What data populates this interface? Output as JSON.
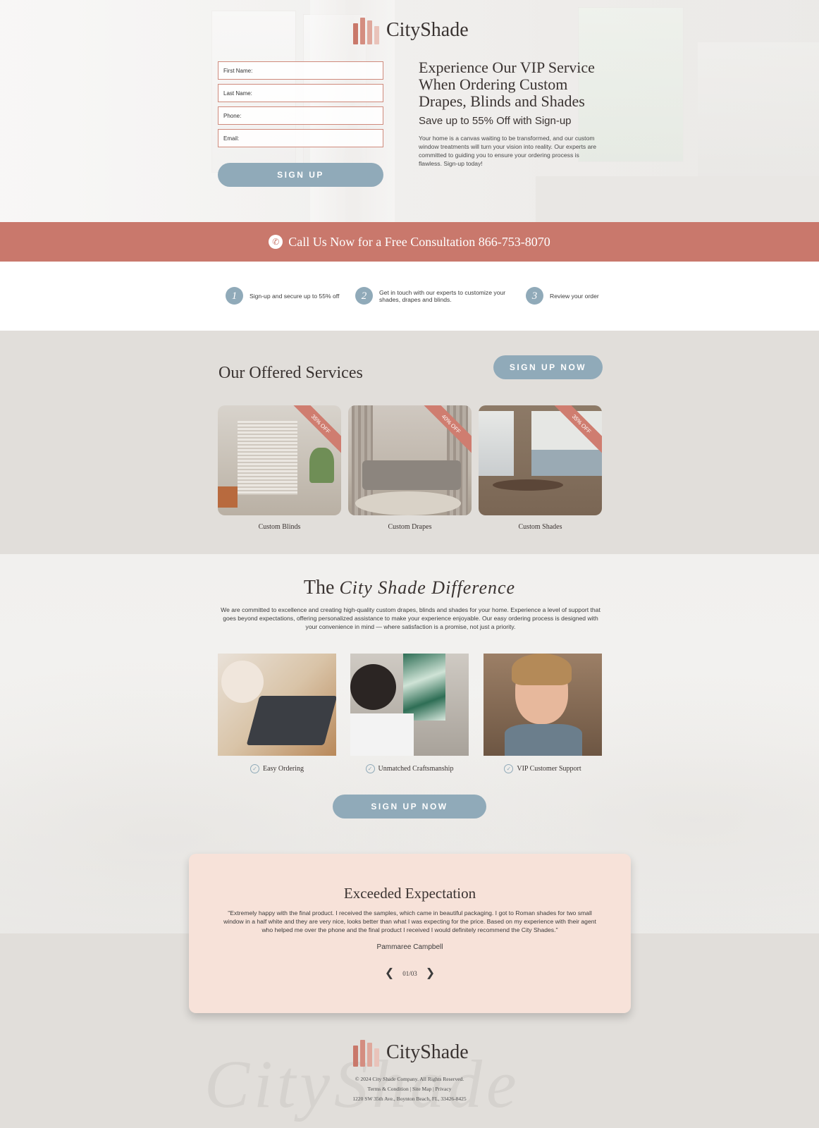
{
  "brand": {
    "name": "CityShade"
  },
  "form": {
    "fields": [
      "First Name:",
      "Last Name:",
      "Phone:",
      "Email:"
    ],
    "submit_label": "SIGN UP"
  },
  "hero": {
    "headline": "Experience Our VIP Service When Ordering Custom Drapes, Blinds and Shades",
    "subheadline": "Save up to 55% Off with Sign-up",
    "body": "Your home is a canvas waiting to be transformed, and our custom window treatments will turn your vision into reality. Our experts are committed to guiding you to ensure your ordering process is flawless. Sign-up today!"
  },
  "cta_bar": {
    "text": "Call Us Now for a Free Consultation 866-753-8070",
    "icon": "phone-icon"
  },
  "steps": [
    {
      "num": "1",
      "text": "Sign-up and secure up to 55% off"
    },
    {
      "num": "2",
      "text": "Get in touch with our experts to customize your shades, drapes and blinds."
    },
    {
      "num": "3",
      "text": "Review your order"
    }
  ],
  "services": {
    "title": "Our Offered Services",
    "button": "SIGN UP NOW",
    "items": [
      {
        "label": "Custom Blinds",
        "badge": "35% OFF"
      },
      {
        "label": "Custom Drapes",
        "badge": "40% OFF"
      },
      {
        "label": "Custom Shades",
        "badge": "35% OFF"
      }
    ]
  },
  "difference": {
    "title_prefix": "The",
    "title_script": "City Shade Difference",
    "body": "We are committed to excellence and creating high-quality custom drapes, blinds and shades for your home. Experience a level of support that goes beyond expectations, offering personalized assistance to make your experience enjoyable. Our easy ordering process is designed with your convenience in mind — where satisfaction is a promise, not just a priority.",
    "features": [
      "Easy Ordering",
      "Unmatched Craftsmanship",
      "VIP Customer Support"
    ],
    "button": "SIGN UP NOW"
  },
  "testimonial": {
    "title": "Exceeded Expectation",
    "quote": "\"Extremely happy with the final product. I received the samples, which came in beautiful packaging. I got to Roman shades for two small window in a half white and they are very nice, looks better than what I was expecting for the price. Based on my experience with their agent who helped me over the phone and the final product I received I would definitely recommend the City Shades.\"",
    "author": "Pammaree Campbell",
    "page": "01/03"
  },
  "footer": {
    "copyright": "© 2024 City Shade Company. All Rights Reserved.",
    "links": "Terms & Condition | Site Map | Privacy",
    "address": "1220 SW 35th Ave., Boynton Beach, FL, 33426-8425"
  },
  "colors": {
    "accent": "#c9786c",
    "button": "#90aab9",
    "testimonial_bg": "#f7e2d9"
  }
}
